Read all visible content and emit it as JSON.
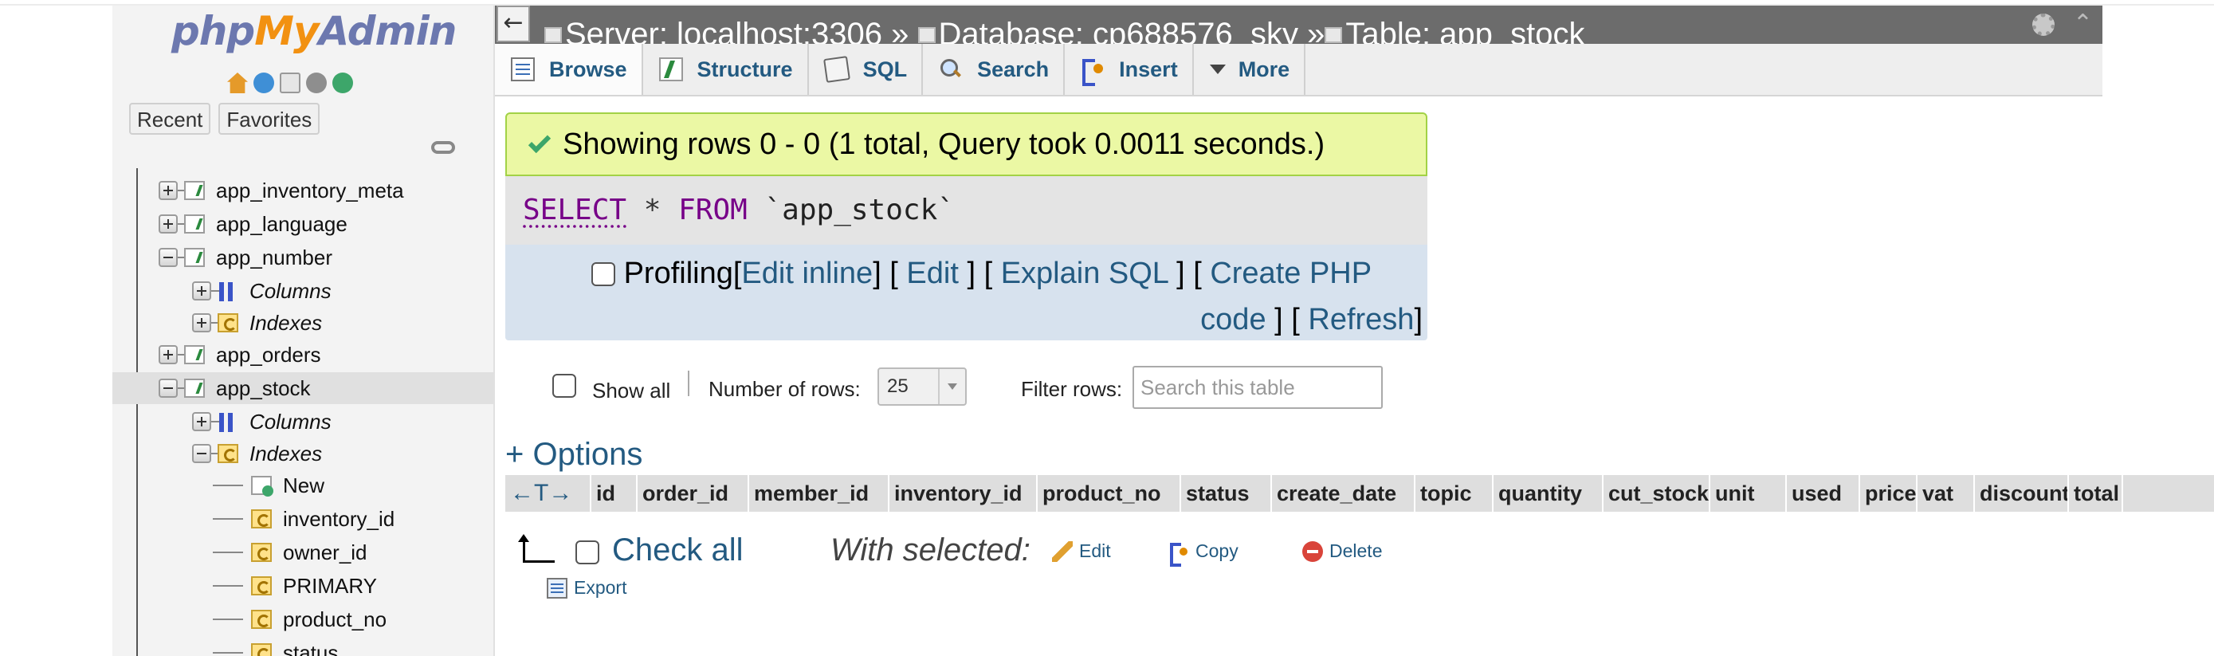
{
  "logo": {
    "php": "php",
    "my": "My",
    "admin": "Admin"
  },
  "nav": {
    "recent_label": "Recent",
    "favorites_label": "Favorites",
    "tree": [
      {
        "label": "app_inventory_meta",
        "kind": "table",
        "expander": "plus"
      },
      {
        "label": "app_language",
        "kind": "table",
        "expander": "plus"
      },
      {
        "label": "app_number",
        "kind": "table",
        "expander": "minus"
      },
      {
        "label": "Columns",
        "kind": "columns",
        "expander": "plus"
      },
      {
        "label": "Indexes",
        "kind": "indexes",
        "expander": "plus"
      },
      {
        "label": "app_orders",
        "kind": "table",
        "expander": "plus"
      },
      {
        "label": "app_stock",
        "kind": "table",
        "expander": "minus",
        "selected": true
      },
      {
        "label": "Columns",
        "kind": "columns",
        "expander": "plus"
      },
      {
        "label": "Indexes",
        "kind": "indexes",
        "expander": "minus"
      },
      {
        "label": "New",
        "kind": "new-index"
      },
      {
        "label": "inventory_id",
        "kind": "index"
      },
      {
        "label": "owner_id",
        "kind": "index"
      },
      {
        "label": "PRIMARY",
        "kind": "index"
      },
      {
        "label": "product_no",
        "kind": "index"
      },
      {
        "label": "status",
        "kind": "index"
      }
    ]
  },
  "breadcrumb": {
    "back": "←",
    "server_label": "Server: localhost:3306",
    "db_label": "Database: cp688576_sky",
    "table_label": "Table: app_stock",
    "sep": "»"
  },
  "tabs": [
    {
      "label": "Browse",
      "icon": "browse-icon"
    },
    {
      "label": "Structure",
      "icon": "structure-icon"
    },
    {
      "label": "SQL",
      "icon": "sql-icon"
    },
    {
      "label": "Search",
      "icon": "search-icon"
    },
    {
      "label": "Insert",
      "icon": "insert-icon"
    },
    {
      "label": "More",
      "icon": "more-icon"
    }
  ],
  "result": {
    "message": "Showing rows 0 - 0 (1 total, Query took 0.0011 seconds.)",
    "sql": {
      "select": "SELECT",
      "star": "*",
      "from": "FROM",
      "table": "`app_stock`"
    },
    "profiling": "Profiling",
    "edit_inline": "Edit inline",
    "edit": "Edit",
    "explain": "Explain SQL",
    "create_php_1": "Create PHP",
    "create_php_2": "code",
    "refresh": "Refresh"
  },
  "rowcontrols": {
    "show_all": "Show all",
    "num_rows_label": "Number of rows:",
    "num_rows_value": "25",
    "filter_label": "Filter rows:",
    "filter_placeholder": "Search this table"
  },
  "options_label": "+ Options",
  "table": {
    "arrows": "←T→",
    "columns": [
      "id",
      "order_id",
      "member_id",
      "inventory_id",
      "product_no",
      "status",
      "create_date",
      "topic",
      "quantity",
      "cut_stock",
      "unit",
      "used",
      "price",
      "vat",
      "discount",
      "total"
    ]
  },
  "actions": {
    "check_all": "Check all",
    "with_selected": "With selected:",
    "edit": "Edit",
    "copy": "Copy",
    "delete": "Delete",
    "export": "Export"
  }
}
